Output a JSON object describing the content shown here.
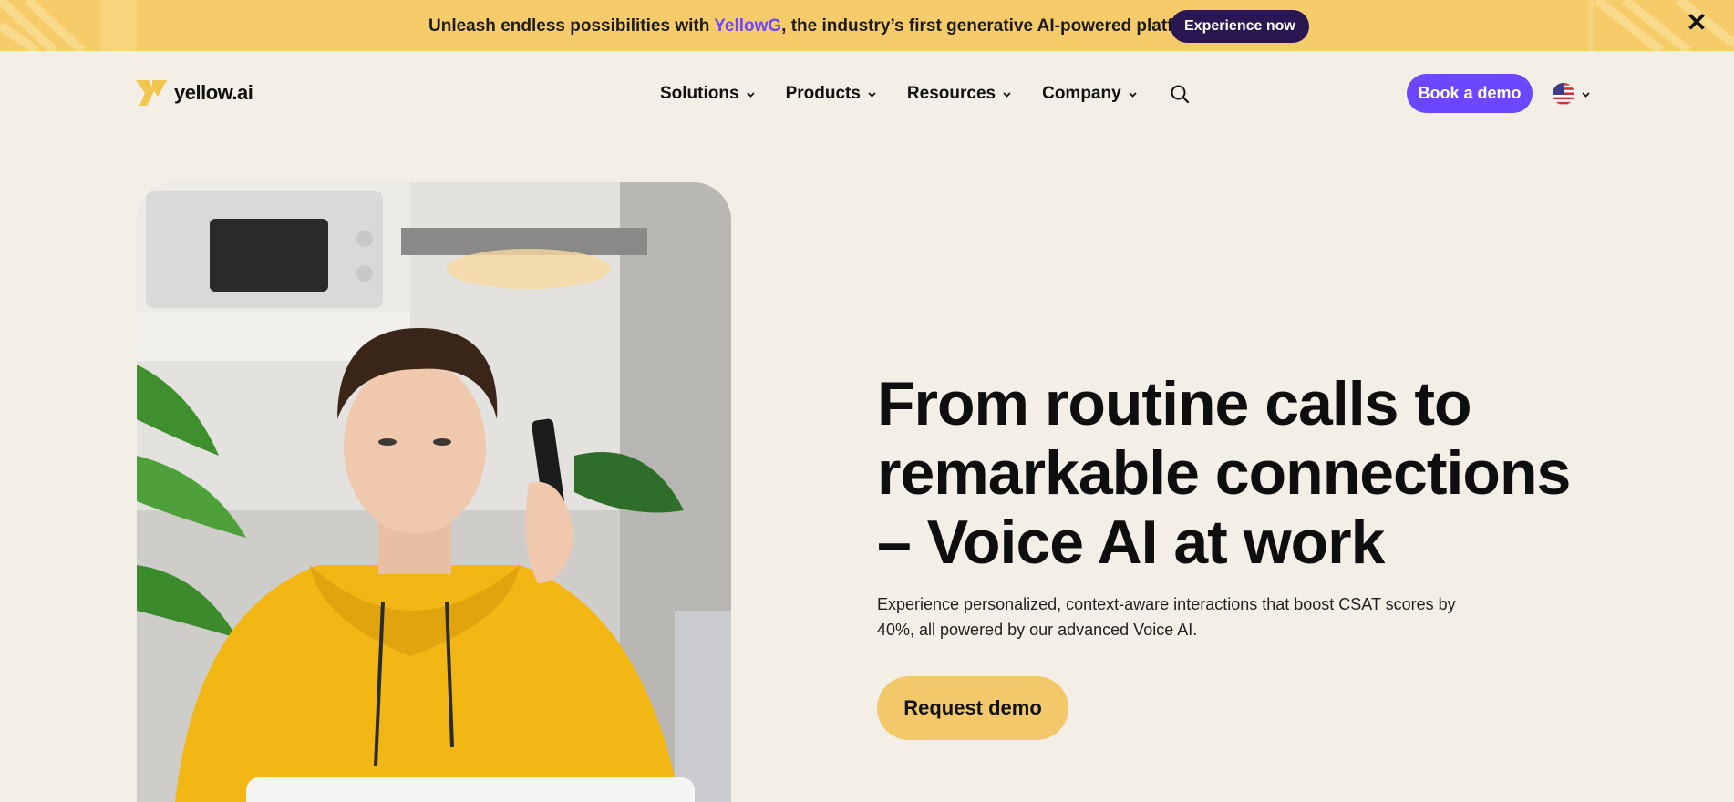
{
  "banner": {
    "text_before": "Unleash endless possibilities with ",
    "brand": "YellowG",
    "text_after": ", the industry’s first generative AI-powered platform!",
    "button_label": "Experience now",
    "close_icon": "close-icon",
    "background": "#f6cc6b",
    "brand_color": "#6b47ff"
  },
  "header": {
    "logo_text": "yellow.ai",
    "nav": [
      {
        "label": "Solutions"
      },
      {
        "label": "Products"
      },
      {
        "label": "Resources"
      },
      {
        "label": "Company"
      }
    ],
    "search_icon": "search-icon",
    "cta_label": "Book a demo",
    "cta_color": "#6b47ff",
    "language_icon": "us-flag-icon"
  },
  "hero": {
    "headline": "From routine calls to remarkable connections – Voice AI at work",
    "subline": "Experience personalized, context-aware interactions that boost CSAT scores by 40%, all powered by our advanced Voice AI.",
    "cta_label": "Request demo",
    "cta_color": "#f3c86a",
    "background": "#f3efe6"
  }
}
